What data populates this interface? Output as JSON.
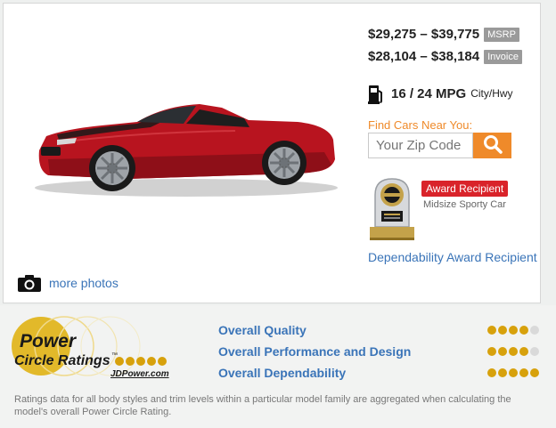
{
  "pricing": {
    "msrp_range": "$29,275 – $39,775",
    "msrp_label": "MSRP",
    "invoice_range": "$28,104 – $38,184",
    "invoice_label": "Invoice"
  },
  "fuel": {
    "mpg": "16 / 24 MPG",
    "unit": "City/Hwy",
    "icon": "fuel-pump-icon"
  },
  "zip_search": {
    "label": "Find Cars Near You:",
    "placeholder": "Your Zip Code",
    "icon": "search-icon"
  },
  "award": {
    "badge": "Award Recipient",
    "category": "Midsize Sporty Car",
    "link": "Dependability Award Recipient",
    "icon": "trophy-icon"
  },
  "photos": {
    "link": "more photos",
    "icon": "camera-icon"
  },
  "power_circle": {
    "logo_line1": "Power",
    "logo_line2": "Circle Ratings",
    "logo_tm": "™",
    "logo_site": "JDPower.com",
    "ratings": [
      {
        "label": "Overall Quality",
        "score": 4,
        "max": 5
      },
      {
        "label": "Overall Performance and Design",
        "score": 4,
        "max": 5
      },
      {
        "label": "Overall Dependability",
        "score": 5,
        "max": 5
      }
    ],
    "disclaimer": "Ratings data for all body styles and trim levels within a particular model family are aggregated when calculating the model's overall Power Circle Rating."
  },
  "colors": {
    "accent_orange": "#ef8a2a",
    "link_blue": "#3a74b8",
    "rating_gold": "#d7a10c",
    "award_red": "#d9232a",
    "car_red": "#b8141f"
  }
}
